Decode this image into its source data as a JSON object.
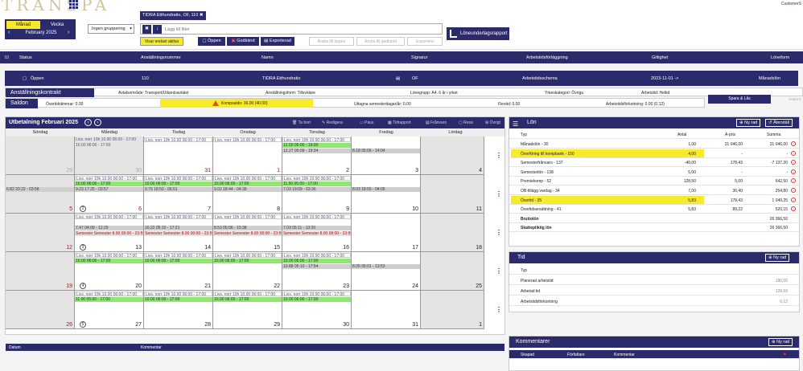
{
  "app": {
    "logo": "TRANSPA",
    "customer": "CustomerS"
  },
  "period": {
    "month_label": "Månad",
    "week_label": "Vecka",
    "prev": "‹",
    "next": "›",
    "label": "February 2025"
  },
  "grouping": {
    "value": "Ingen gruppering"
  },
  "filter": {
    "chip": "TIDRA Etthundratio, OF, 110",
    "chip_close": "✖",
    "placeholder": "Lägg till filter",
    "only_active": "Visar endast aktiva"
  },
  "actions": {
    "open": "Öppen",
    "approve": "Godkänd",
    "export": "Exporterad",
    "change_open": "Ändra till öppen",
    "change_approved": "Ändra till godkänd",
    "export_g": "Exportera",
    "payroll_report": "Löneunderlagsrapport"
  },
  "list_header": {
    "status": "Status",
    "empno": "Anställningsnummer",
    "name": "Namn",
    "signature": "Signatur",
    "schedule": "Arbetstidsförläggning",
    "validity": "Giltighet",
    "payform": "Löneform"
  },
  "selected": {
    "status": "Öppen",
    "empno": "110",
    "name": "TIDRA Etthundratio",
    "signature": "OF",
    "schedule": "Arbetstidsschema",
    "validity": "2023-11-01 ->",
    "payform": "Månadslön"
  },
  "contract": {
    "label": "Anställningskontrakt",
    "area": "Avtalsområde: Transport/Utlandsavtalet",
    "form": "Anställningsform: Tillsvidare",
    "group": "Lönegrupp: A4. 6 år i yrket",
    "category": "Yrkeskategori: Övriga",
    "worktime": "Arbetstid: Heltid"
  },
  "balances": {
    "label": "Saldon",
    "overtime": "Övertidstimmar: 0.00",
    "komp": "Kompsaldo: 36.00 (40.00)",
    "vacation": "Uttagna semesterdagar/år: 0.00",
    "flex": "Flextid: 0.00",
    "reduction": "Arbetstidsförkortning: 0.00 (0.12)",
    "save_lock": "Spara & Lås",
    "change_faded": "Ändra ti"
  },
  "calendar": {
    "title": "Utbetalning Februari 2025",
    "prev": "‹",
    "next": "›",
    "actions": [
      "Ta bort",
      "Redigera",
      "Paus",
      "Tidrapport",
      "Frånvaro",
      "Resa",
      "Övrigt"
    ],
    "days": [
      "Söndag",
      "Måndag",
      "Tisdag",
      "Onsdag",
      "Torsdag",
      "Fredag",
      "Lördag"
    ],
    "weeks": [
      {
        "wk": "",
        "nums": [
          "29",
          "30",
          "31",
          "1",
          "2",
          "3",
          "4"
        ]
      },
      {
        "wk": "2",
        "nums": [
          "5",
          "6",
          "7",
          "8",
          "9",
          "10",
          "11"
        ]
      },
      {
        "wk": "3",
        "nums": [
          "12",
          "13",
          "14",
          "15",
          "16",
          "17",
          "18"
        ]
      },
      {
        "wk": "4",
        "nums": [
          "19",
          "20",
          "21",
          "22",
          "23",
          "24",
          "25"
        ]
      },
      {
        "wk": "5",
        "nums": [
          "26",
          "27",
          "28",
          "29",
          "30",
          "31",
          "1"
        ]
      }
    ],
    "events": [
      {
        "w": 0,
        "d": 1,
        "row": 0,
        "style": "plain",
        "text": "Livs. norr 10h 10.00 06:00 - 17:00"
      },
      {
        "w": 0,
        "d": 1,
        "row": 1,
        "style": "plain",
        "text": "10.00 06:00 - 17:00"
      },
      {
        "w": 0,
        "d": 2,
        "row": 0,
        "style": "white",
        "text": "Livs. norr 10h 10.00 06:00 - 17:00"
      },
      {
        "w": 0,
        "d": 3,
        "row": 0,
        "style": "white",
        "text": "Livs. norr 10h 10.00 06:00 - 17:00"
      },
      {
        "w": 0,
        "d": 4,
        "row": 0,
        "style": "white",
        "text": "Livs. norr 10h 10.00 06:00 - 17:00"
      },
      {
        "w": 0,
        "d": 4,
        "row": 1,
        "style": "green",
        "text": "12.50 05:00 - 19:00"
      },
      {
        "w": 0,
        "d": 4,
        "row": 2,
        "style": "grey",
        "text": "12.27 05:09 - 19:34"
      },
      {
        "w": 0,
        "d": 5,
        "row": 2,
        "style": "grey",
        "text": "8.18 05:06 - 14:04"
      },
      {
        "w": 1,
        "d": 1,
        "row": 0,
        "style": "white",
        "text": "Livs. norr 10h 10.00 06:00 - 17:00"
      },
      {
        "w": 1,
        "d": 1,
        "row": 1,
        "style": "green",
        "text": "10.00 06:00 - 17:00"
      },
      {
        "w": 1,
        "d": 1,
        "row": 2,
        "style": "grey",
        "text": "9.23 17:25 - 03:57"
      },
      {
        "w": 1,
        "d": 0,
        "row": 2,
        "style": "grey",
        "text": "6.82 20:22 - 03:58"
      },
      {
        "w": 1,
        "d": 2,
        "row": 0,
        "style": "white",
        "text": "Livs. norr 10h 10.00 06:00 - 17:00"
      },
      {
        "w": 1,
        "d": 2,
        "row": 1,
        "style": "green",
        "text": "10.00 06:00 - 17:00"
      },
      {
        "w": 1,
        "d": 2,
        "row": 2,
        "style": "grey",
        "text": "9.75 18:50 - 06:51"
      },
      {
        "w": 1,
        "d": 3,
        "row": 0,
        "style": "white",
        "text": "Livs. norr 10h 10.00 06:00 - 17:00"
      },
      {
        "w": 1,
        "d": 3,
        "row": 1,
        "style": "green",
        "text": "10.00 06:00 - 17:00"
      },
      {
        "w": 1,
        "d": 3,
        "row": 2,
        "style": "grey",
        "text": "9.02 18:44 - 04:39"
      },
      {
        "w": 1,
        "d": 4,
        "row": 0,
        "style": "white",
        "text": "Livs. norr 10h 10.00 06:00 - 17:00"
      },
      {
        "w": 1,
        "d": 4,
        "row": 1,
        "style": "green",
        "text": "11.50 05:00 - 17:00"
      },
      {
        "w": 1,
        "d": 4,
        "row": 2,
        "style": "grey",
        "text": "7.03 19:09 - 03:36"
      },
      {
        "w": 1,
        "d": 5,
        "row": 2,
        "style": "grey",
        "text": "8.03 18:55 - 04:05"
      },
      {
        "w": 2,
        "d": 1,
        "row": 0,
        "style": "white",
        "text": "Livs. norr 10h 10.00 06:00 - 17:00"
      },
      {
        "w": 2,
        "d": 1,
        "row": 2,
        "style": "grey",
        "text": "7.47 04:09 - 12:29"
      },
      {
        "w": 2,
        "d": 1,
        "row": 3,
        "style": "red",
        "text": "Semester Semester 8.00 00:00 - 23:59"
      },
      {
        "w": 2,
        "d": 2,
        "row": 0,
        "style": "white",
        "text": "Livs. norr 10h 10.00 06:00 - 17:00"
      },
      {
        "w": 2,
        "d": 2,
        "row": 2,
        "style": "grey",
        "text": "10.22 05:10 - 17:21"
      },
      {
        "w": 2,
        "d": 2,
        "row": 3,
        "style": "red",
        "text": "Semester Semester 8.00 00:00 - 23:59"
      },
      {
        "w": 2,
        "d": 3,
        "row": 0,
        "style": "white",
        "text": "Livs. norr 10h 10.00 06:00 - 17:00"
      },
      {
        "w": 2,
        "d": 3,
        "row": 2,
        "style": "grey",
        "text": "8.53 05:06 - 15:38"
      },
      {
        "w": 2,
        "d": 3,
        "row": 3,
        "style": "red",
        "text": "Semester Semester 8.00 00:00 - 23:59"
      },
      {
        "w": 2,
        "d": 4,
        "row": 0,
        "style": "white",
        "text": "Livs. norr 10h 10.00 06:00 - 17:00"
      },
      {
        "w": 2,
        "d": 4,
        "row": 2,
        "style": "grey",
        "text": "7.03 05:11 - 13:20"
      },
      {
        "w": 2,
        "d": 4,
        "row": 3,
        "style": "red",
        "text": "Semester Semester 8.00 00:00 - 23:59"
      },
      {
        "w": 3,
        "d": 1,
        "row": 0,
        "style": "white",
        "text": "Livs. norr 10h 10.00 06:00 - 17:00"
      },
      {
        "w": 3,
        "d": 1,
        "row": 1,
        "style": "green",
        "text": "10.00 06:00 - 17:00"
      },
      {
        "w": 3,
        "d": 2,
        "row": 0,
        "style": "white",
        "text": "Livs. norr 10h 10.00 06:00 - 17:00"
      },
      {
        "w": 3,
        "d": 2,
        "row": 1,
        "style": "green",
        "text": "10.00 06:00 - 17:00"
      },
      {
        "w": 3,
        "d": 3,
        "row": 0,
        "style": "white",
        "text": "Livs. norr 10h 10.00 06:00 - 17:00"
      },
      {
        "w": 3,
        "d": 3,
        "row": 1,
        "style": "green",
        "text": "10.00 06:00 - 17:00"
      },
      {
        "w": 3,
        "d": 4,
        "row": 0,
        "style": "white",
        "text": "Livs. norr 10h 10.00 06:00 - 17:00"
      },
      {
        "w": 3,
        "d": 4,
        "row": 1,
        "style": "green",
        "text": "10.00 06:00 - 17:00"
      },
      {
        "w": 3,
        "d": 4,
        "row": 2,
        "style": "grey",
        "text": "10.88 05:10 - 17:54"
      },
      {
        "w": 3,
        "d": 5,
        "row": 2,
        "style": "grey",
        "text": "8.05 05:01 - 13:53"
      },
      {
        "w": 4,
        "d": 1,
        "row": 0,
        "style": "white",
        "text": "Livs. norr 10h 10.00 06:00 - 17:00"
      },
      {
        "w": 4,
        "d": 1,
        "row": 1,
        "style": "green",
        "text": "11.00 05:00 - 17:00"
      },
      {
        "w": 4,
        "d": 2,
        "row": 0,
        "style": "white",
        "text": "Livs. norr 10h 10.00 06:00 - 17:00"
      },
      {
        "w": 4,
        "d": 2,
        "row": 1,
        "style": "green",
        "text": "10.00 06:00 - 17:00"
      },
      {
        "w": 4,
        "d": 3,
        "row": 0,
        "style": "white",
        "text": "Livs. norr 10h 10.00 06:00 - 17:00"
      },
      {
        "w": 4,
        "d": 3,
        "row": 1,
        "style": "green",
        "text": "10.00 06:00 - 17:00"
      },
      {
        "w": 4,
        "d": 4,
        "row": 0,
        "style": "white",
        "text": "Livs. norr 10h 10.00 06:00 - 17:00"
      },
      {
        "w": 4,
        "d": 4,
        "row": 1,
        "style": "green",
        "text": "10.00 06:00 - 17:00"
      }
    ],
    "footer": {
      "date": "Datum",
      "comment": "Kommentar"
    }
  },
  "lon": {
    "title": "Lön",
    "new_row": "Ny rad",
    "reset": "Återställ",
    "cols": [
      "Typ",
      "Antal",
      "À-pris",
      "Summa"
    ],
    "rows": [
      {
        "typ": "Månadslön - 30",
        "antal": "1,00",
        "apris": "31 046,00",
        "summa": "31 046,00",
        "hl": false,
        "rm": true
      },
      {
        "typ": "Överföring till kompbank - 150",
        "antal": "4,00",
        "apris": "-",
        "summa": "-",
        "hl": true,
        "rm": true
      },
      {
        "typ": "Semesterfrånvaro - 137",
        "antal": "-40,00",
        "apris": "178,43",
        "summa": "-7 137,20",
        "hl": false,
        "rm": true
      },
      {
        "typ": "Semesterlön - 138",
        "antal": "5,00",
        "apris": "-",
        "summa": "-",
        "hl": false,
        "rm": true
      },
      {
        "typ": "Premiekomp - 52",
        "antal": "128,50",
        "apris": "5,00",
        "summa": "642,50",
        "hl": false,
        "rm": true
      },
      {
        "typ": "OB-tillägg vardag - 34",
        "antal": "7,00",
        "apris": "36,40",
        "summa": "254,80",
        "hl": false,
        "rm": true
      },
      {
        "typ": "Övertid - 35",
        "antal": "5,83",
        "apris": "178,43",
        "summa": "1 040,25",
        "hl": true,
        "rm": true
      },
      {
        "typ": "Övertidsersättning - 41",
        "antal": "5,83",
        "apris": "89,22",
        "summa": "520,15",
        "hl": false,
        "rm": true
      },
      {
        "typ": "Bruttolön",
        "antal": "",
        "apris": "",
        "summa": "26 366,50",
        "hl": false,
        "rm": false
      },
      {
        "typ": "Skattepliktig lön",
        "antal": "",
        "apris": "",
        "summa": "26 366,50",
        "hl": false,
        "rm": false
      }
    ]
  },
  "tid": {
    "title": "Tid",
    "new_row": "Ny rad",
    "col": "Typ",
    "rows": [
      {
        "typ": "Planerad arbetstid",
        "val": "180,00"
      },
      {
        "typ": "Arbetad tid",
        "val": "128,50"
      },
      {
        "typ": "Arbetstidsförkortning",
        "val": "0,12"
      }
    ]
  },
  "komm": {
    "title": "Kommentarer",
    "new_row": "Ny rad",
    "cols": [
      "Skapad",
      "Författare",
      "Kommentar"
    ]
  },
  "colors": {
    "navy": "#2b2a6b",
    "yellow": "#f6ea2a",
    "green": "#8ee870",
    "red": "#d33333"
  }
}
